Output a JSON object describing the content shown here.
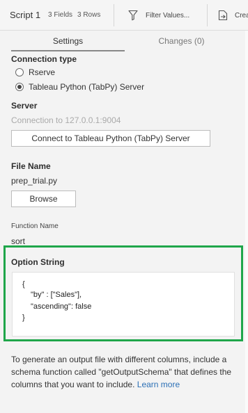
{
  "header": {
    "script_title": "Script 1",
    "fields_count": "3 Fields",
    "rows_count": "3 Rows",
    "filter_label": "Filter Values...",
    "create_label": "Crea"
  },
  "tabs": [
    {
      "label": "Settings"
    },
    {
      "label": "Changes (0)"
    }
  ],
  "connection": {
    "heading": "Connection type",
    "options": [
      {
        "label": "Rserve",
        "checked": false
      },
      {
        "label": "Tableau Python (TabPy) Server",
        "checked": true
      }
    ]
  },
  "server": {
    "heading": "Server",
    "status": "Connection to 127.0.0.1:9004",
    "connect_button": "Connect to Tableau Python (TabPy) Server"
  },
  "file": {
    "heading": "File Name",
    "value": "prep_trial.py",
    "browse_button": "Browse"
  },
  "function": {
    "heading": "Function Name",
    "value": "sort"
  },
  "option_string": {
    "heading": "Option String",
    "lines": [
      "{",
      "\"by\" : [\"Sales\"],",
      "\"ascending\": false",
      "}"
    ]
  },
  "help": {
    "text": "To generate an output file with different columns, include a schema function called \"getOutputSchema\" that defines the columns that you want to include.",
    "link": "Learn more"
  },
  "colors": {
    "highlight_border": "#1fa64a",
    "link": "#2b6fb5"
  }
}
